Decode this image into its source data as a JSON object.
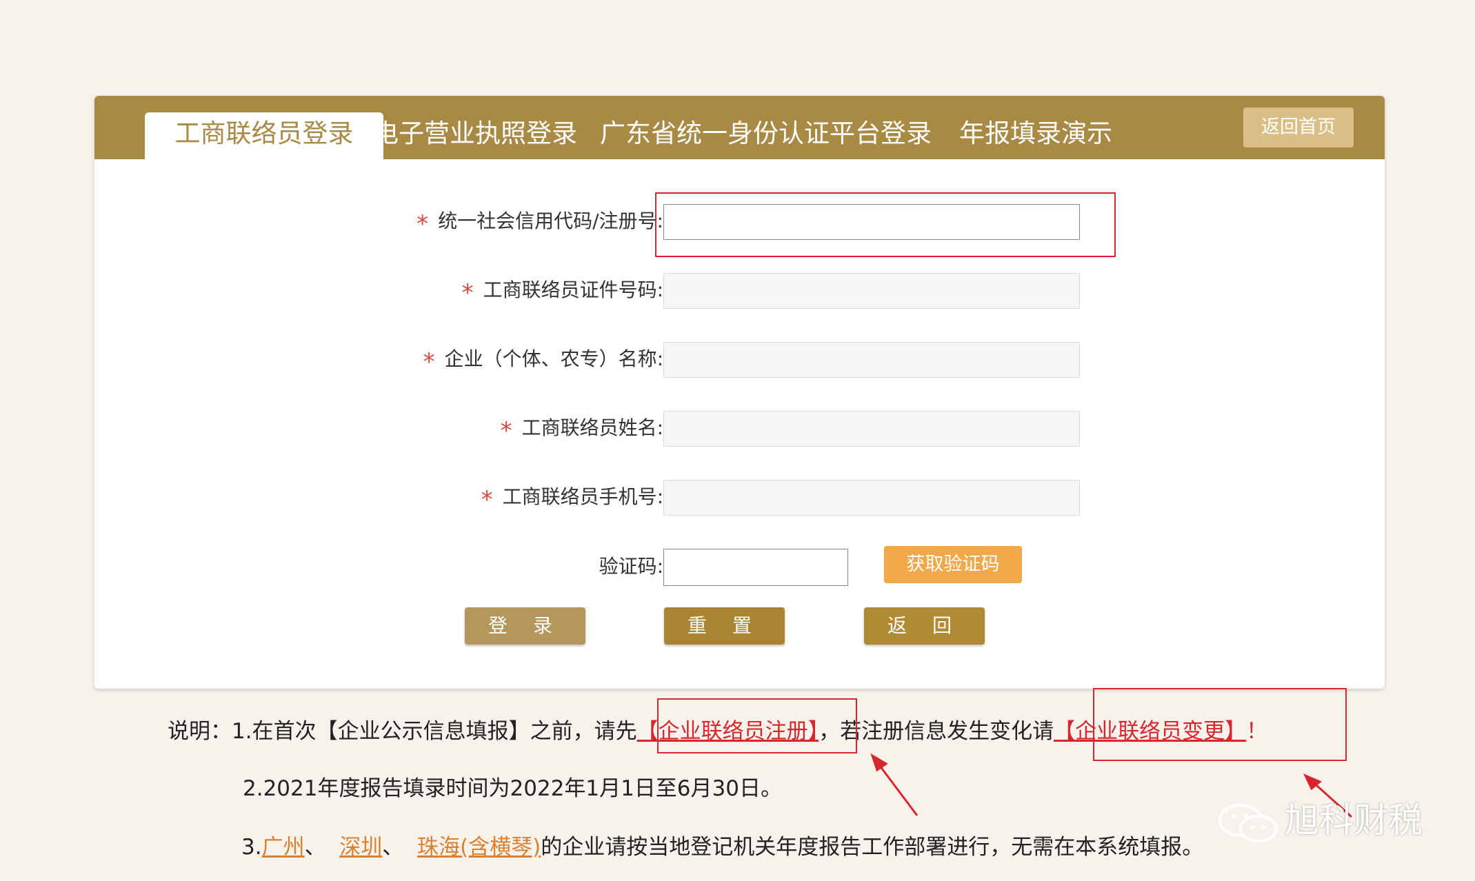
{
  "tabs": {
    "active": "工商联络员登录",
    "license": "电子营业执照登录",
    "gd_identity": "广东省统一身份认证平台登录",
    "demo": "年报填录演示",
    "home": "返回首页"
  },
  "form": {
    "required_mark": "*",
    "credit_code_label": "统一社会信用代码/注册号:",
    "liaison_id_label": "工商联络员证件号码:",
    "company_name_label": "企业（个体、农专）名称:",
    "liaison_name_label": "工商联络员姓名:",
    "liaison_phone_label": "工商联络员手机号:",
    "captcha_label": "验证码:",
    "get_code_button": "获取验证码",
    "login_button": "登 录",
    "reset_button": "重 置",
    "back_button": "返 回"
  },
  "notes": {
    "line1_prefix": "说明：1.在首次【企业公示信息填报】之前，请先",
    "register_link": "【企业联络员注册】",
    "line1_middle": "，若注册信息发生变化请",
    "change_link": "【企业联络员变更】",
    "line1_suffix": "！",
    "line2": "2.2021年度报告填录时间为2022年1月1日至6月30日。",
    "line3_prefix": "3.",
    "city_guangzhou": "广州",
    "sep1": "、",
    "city_shenzhen": "深圳",
    "sep2": "、",
    "city_zhuhai": "珠海(含横琴)",
    "line3_suffix": "的企业请按当地登记机关年度报告工作部署进行，无需在本系统填报。"
  },
  "watermark": "旭科财税",
  "colors": {
    "tabbar": "#a88a45",
    "accent_red": "#d8262f",
    "sms_button": "#f0a84a",
    "login_button": "#b3975c",
    "reset_button": "#a88433",
    "back_button": "#b08a35"
  }
}
